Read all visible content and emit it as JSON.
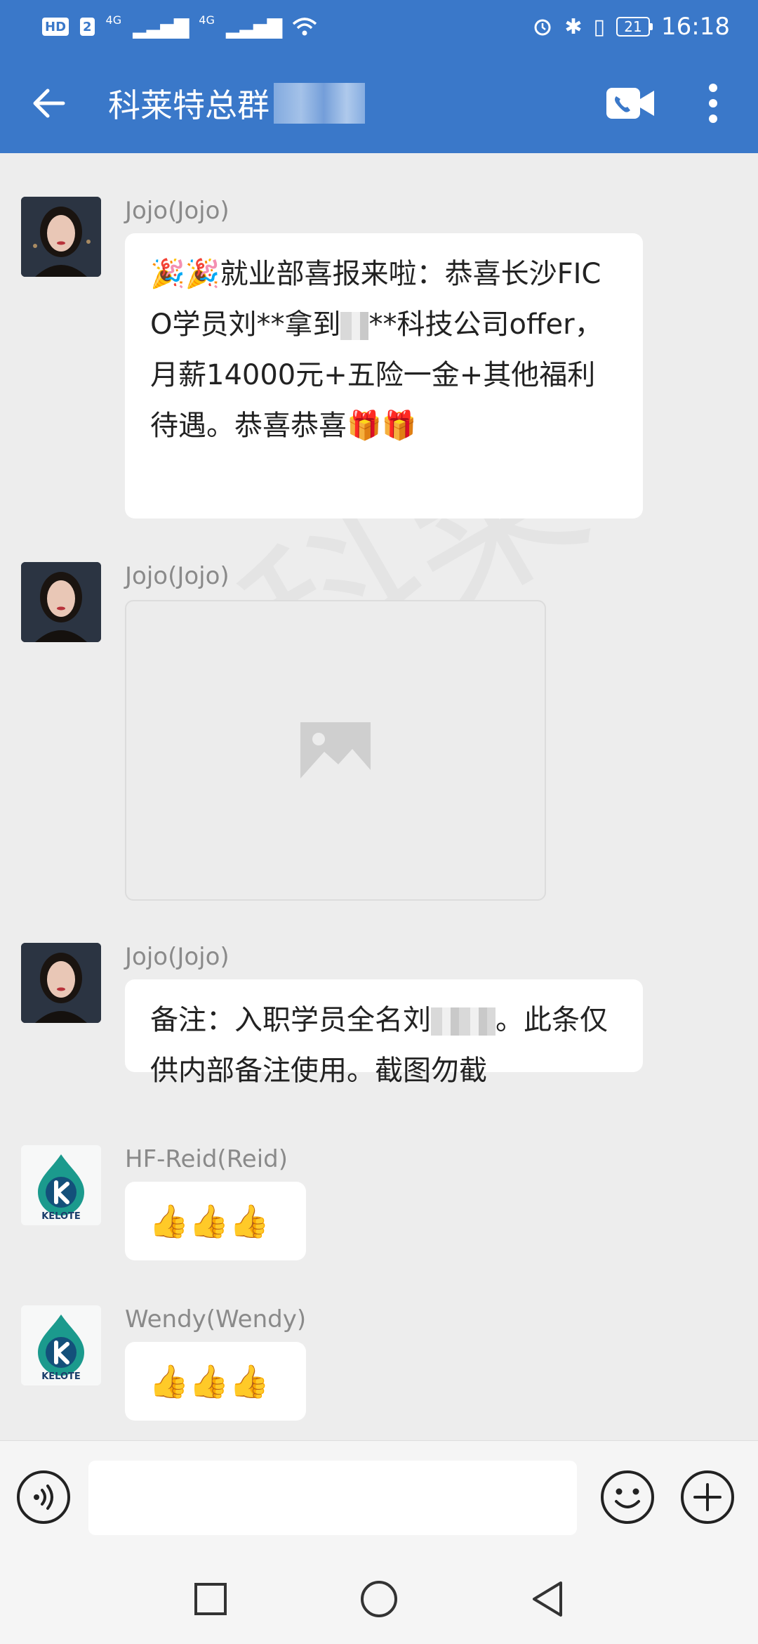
{
  "status_bar": {
    "hd": "HD",
    "sim": "2",
    "net1": "4G",
    "net2": "4G",
    "battery": "21",
    "time": "16:18"
  },
  "header": {
    "title": "科莱特总群",
    "icons": [
      "back-arrow-icon",
      "video-call-icon",
      "more-vertical-icon"
    ]
  },
  "messages": [
    {
      "sender": "Jojo(Jojo)",
      "avatar": "photo",
      "text_parts": [
        "🎉🎉就业部喜报来啦：恭喜长沙FICO学员刘**拿到",
        "**科技公司offer，月薪14000元+五险一金+其他福利待遇。恭喜恭喜🎁🎁"
      ]
    },
    {
      "sender": "Jojo(Jojo)",
      "avatar": "photo",
      "image": "image-placeholder-icon"
    },
    {
      "sender": "Jojo(Jojo)",
      "avatar": "photo",
      "text_parts": [
        "备注：入职学员全名刘",
        "。此条仅供内部备注使用。截图勿截"
      ]
    },
    {
      "sender": "HF-Reid(Reid)",
      "avatar": "KELOTE",
      "emoji": "👍👍👍"
    },
    {
      "sender": "Wendy(Wendy)",
      "avatar": "KELOTE",
      "emoji": "👍👍👍"
    }
  ],
  "input_bar": {
    "placeholder": "",
    "icons": [
      "voice-icon",
      "emoji-icon",
      "plus-icon"
    ]
  },
  "nav_bar": {
    "icons": [
      "recent-apps-icon",
      "home-icon",
      "back-icon"
    ]
  }
}
